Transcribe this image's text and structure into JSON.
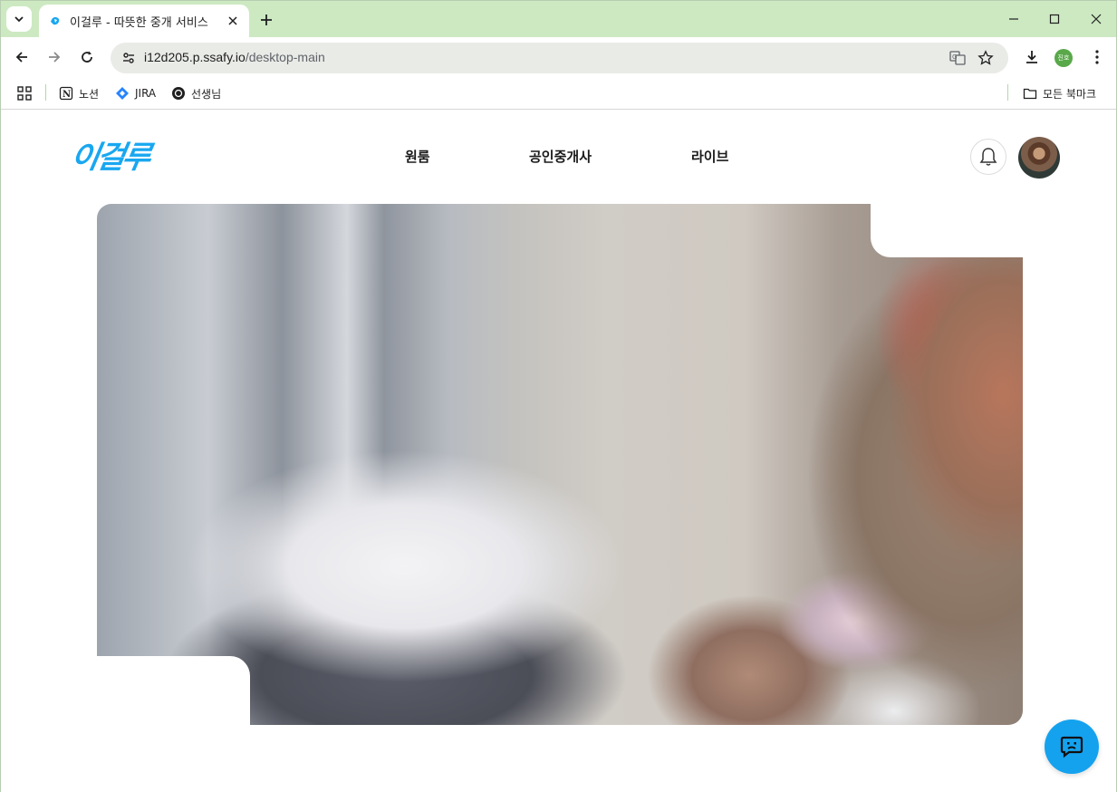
{
  "browser": {
    "tab_title": "이걸루 - 따뜻한 중개 서비스",
    "url_host": "i12d205.p.ssafy.io",
    "url_path": "/desktop-main",
    "profile_initials": "진호"
  },
  "bookmarks": {
    "items": [
      {
        "label": "노션",
        "icon": "notion-icon"
      },
      {
        "label": "JIRA",
        "icon": "jira-icon"
      },
      {
        "label": "선생님",
        "icon": "openai-icon"
      }
    ],
    "all_bookmarks_label": "모든 북마크"
  },
  "site": {
    "logo_text": "이걸루",
    "nav": [
      {
        "label": "원룸"
      },
      {
        "label": "공인중개사"
      },
      {
        "label": "라이브"
      }
    ]
  },
  "colors": {
    "brand": "#19a7f0",
    "tab_strip": "#cde9c2",
    "chat_button": "#14a2ef"
  }
}
